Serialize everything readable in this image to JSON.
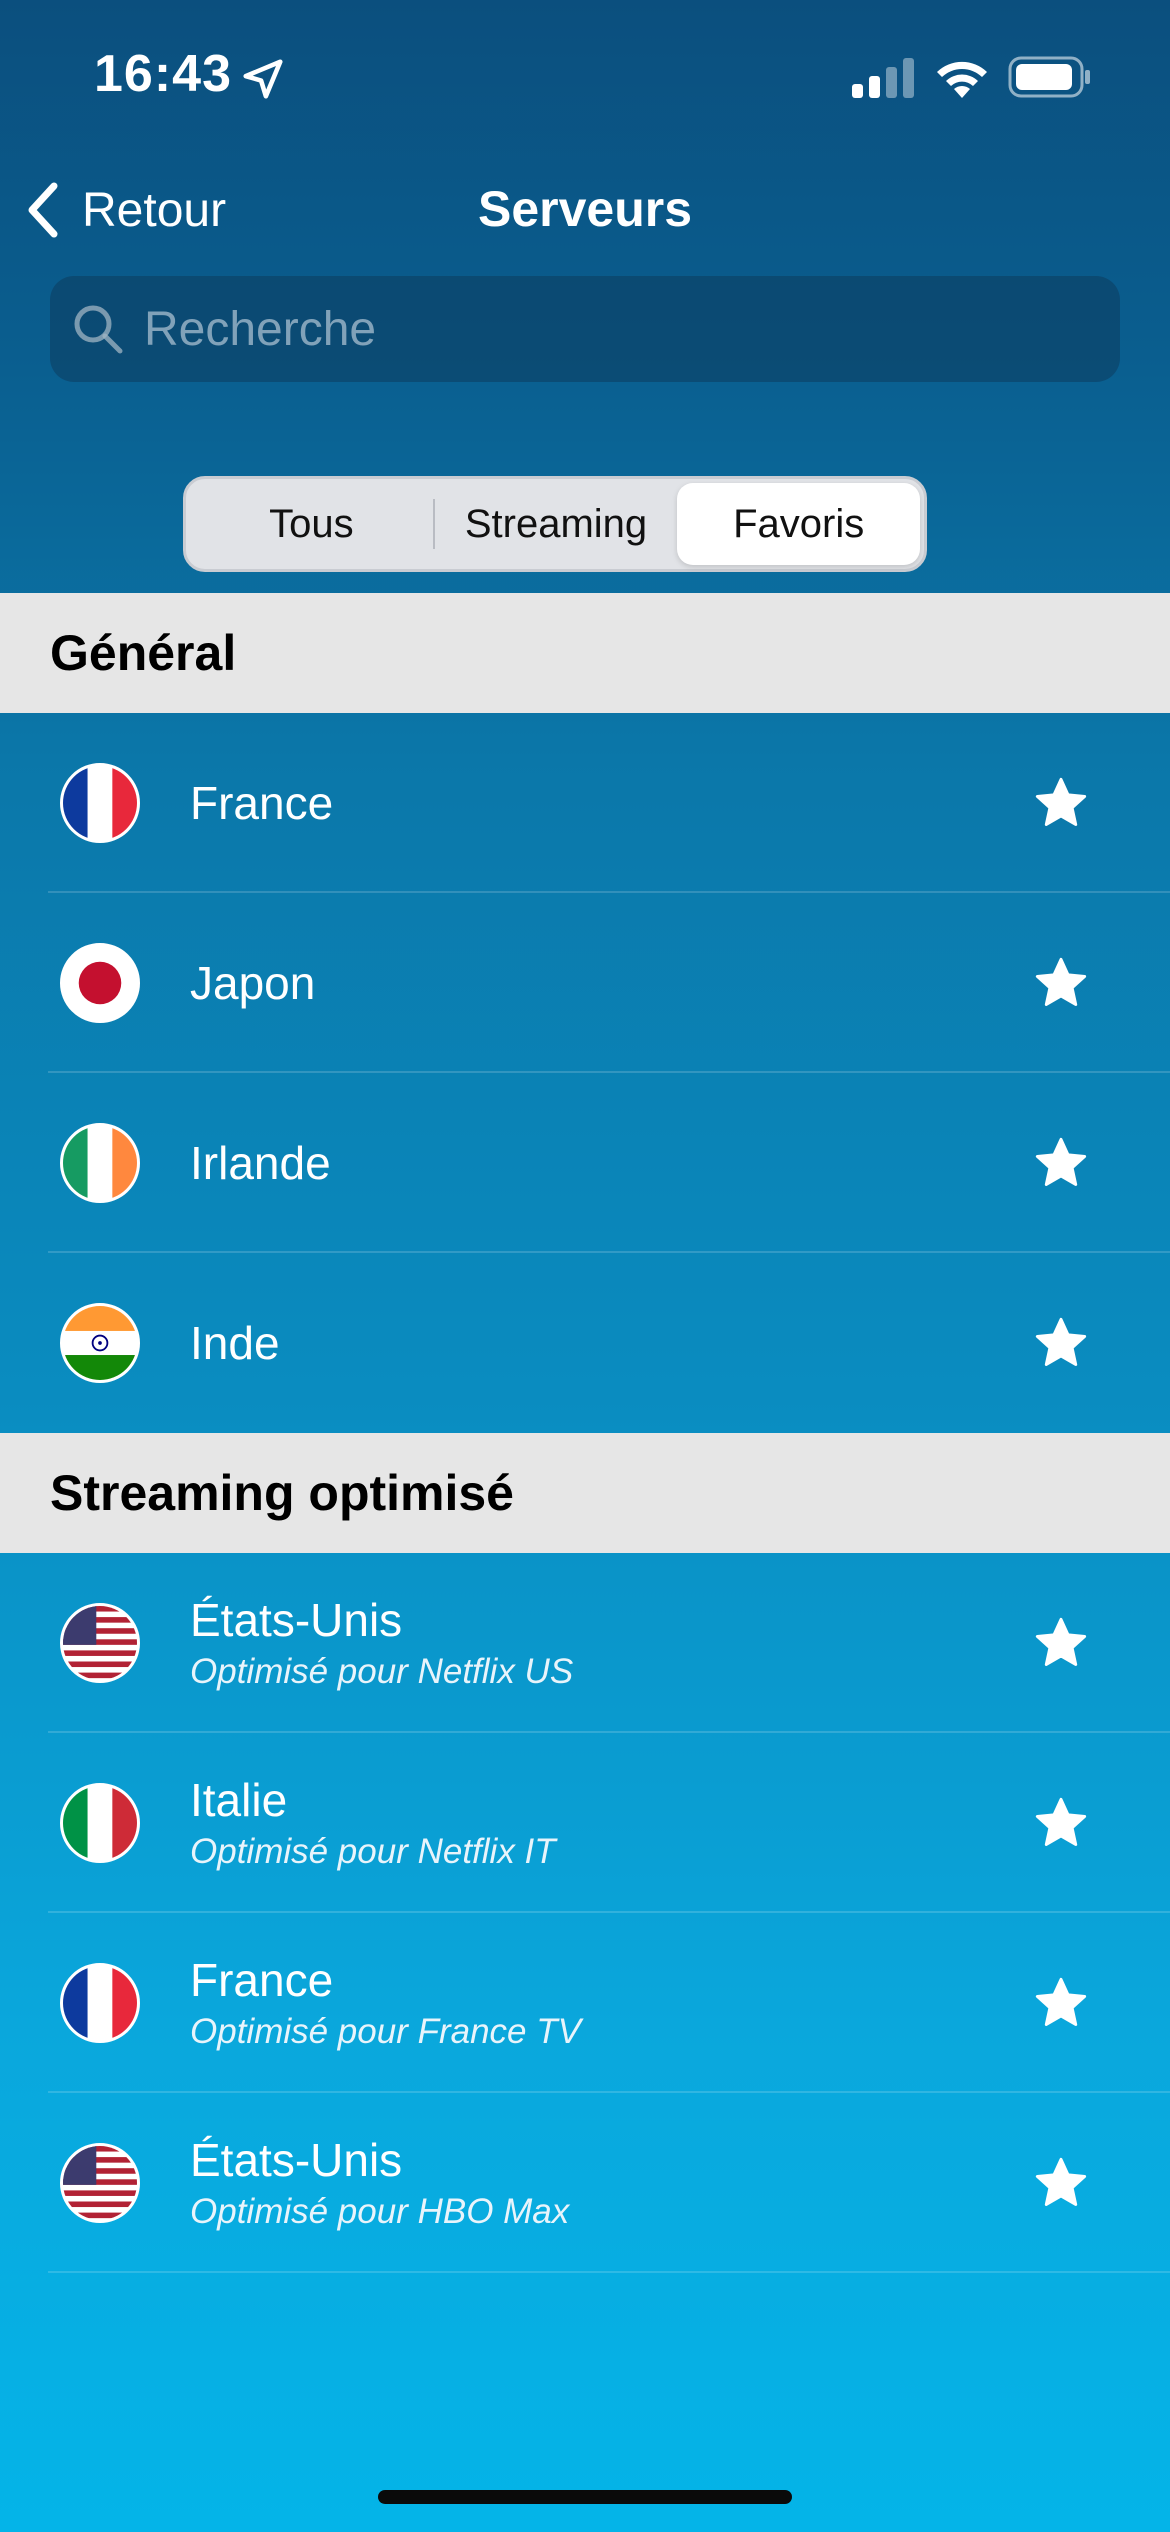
{
  "status_bar": {
    "time": "16:43"
  },
  "nav": {
    "back_label": "Retour",
    "title": "Serveurs"
  },
  "search": {
    "placeholder": "Recherche"
  },
  "segments": [
    "Tous",
    "Streaming",
    "Favoris"
  ],
  "active_segment": "Favoris",
  "sections": [
    {
      "header": "Général",
      "rows": [
        {
          "country": "France",
          "flag": "france-flag-icon",
          "favorite": true
        },
        {
          "country": "Japon",
          "flag": "japan-flag-icon",
          "favorite": true
        },
        {
          "country": "Irlande",
          "flag": "ireland-flag-icon",
          "favorite": true
        },
        {
          "country": "Inde",
          "flag": "india-flag-icon",
          "favorite": true
        }
      ]
    },
    {
      "header": "Streaming optimisé",
      "rows": [
        {
          "country": "États-Unis",
          "subtitle": "Optimisé pour Netflix US",
          "flag": "usa-flag-icon",
          "favorite": true
        },
        {
          "country": "Italie",
          "subtitle": "Optimisé pour Netflix IT",
          "flag": "italy-flag-icon",
          "favorite": true
        },
        {
          "country": "France",
          "subtitle": "Optimisé pour France TV",
          "flag": "france-flag-icon",
          "favorite": true
        },
        {
          "country": "États-Unis",
          "subtitle": "Optimisé pour HBO Max",
          "flag": "usa-flag-icon",
          "favorite": true
        }
      ]
    }
  ],
  "colors": {
    "background_top": "#0b4f7e",
    "background_bottom": "#04b4e8",
    "section_header": "#e6e6e6"
  }
}
